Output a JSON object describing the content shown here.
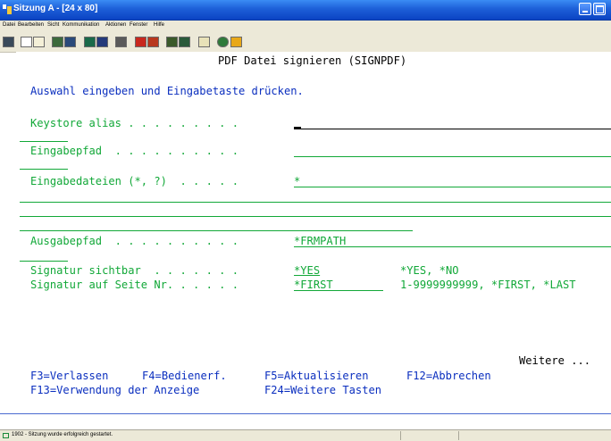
{
  "window": {
    "title": "Sitzung A - [24 x 80]"
  },
  "menu": [
    "Datei",
    "Bearbeiten",
    "Sicht",
    "Kommunikation",
    "Aktionen",
    "Fenster",
    "Hilfe"
  ],
  "toolbar": {
    "buttons": [
      "print-screen",
      "copy",
      "paste",
      "send",
      "receive",
      "display",
      "keypad",
      "macro-record",
      "macro-stop",
      "play",
      "transfer",
      "clipboard",
      "globe",
      "edit"
    ]
  },
  "screen": {
    "title": "PDF Datei signieren (SIGNPDF)",
    "instruction": "Auswahl eingeben und Eingabetaste drücken.",
    "fields": {
      "keystore": {
        "label": "Keystore alias . . . . . . . . .",
        "value": ""
      },
      "eingabepfad": {
        "label": "Eingabepfad  . . . . . . . . . .",
        "value": ""
      },
      "eingabedateien": {
        "label": "Eingabedateien (*, ?)  . . . . .",
        "value": "*"
      },
      "ausgabepfad": {
        "label": "Ausgabepfad  . . . . . . . . . .",
        "value": "*FRMPATH"
      },
      "signatur_sichtbar": {
        "label": "Signatur sichtbar  . . . . . . .",
        "value": "*YES",
        "hint": "*YES, *NO"
      },
      "signatur_seite": {
        "label": "Signatur auf Seite Nr. . . . . .",
        "value": "*FIRST",
        "hint": "1-9999999999, *FIRST, *LAST"
      }
    },
    "more": "Weitere ...",
    "fkeys_row1": [
      "F3=Verlassen",
      "F4=Bedienerf.",
      "F5=Aktualisieren",
      "F12=Abbrechen"
    ],
    "fkeys_row2": [
      "F13=Verwendung der Anzeige",
      "F24=Weitere Tasten"
    ]
  },
  "status": {
    "text": "1902 - Sitzung wurde erfolgreich gestartet."
  },
  "colors": {
    "field": "#12a838",
    "heading": "#0b2fbf",
    "titlebar": "#1d5fd8"
  }
}
